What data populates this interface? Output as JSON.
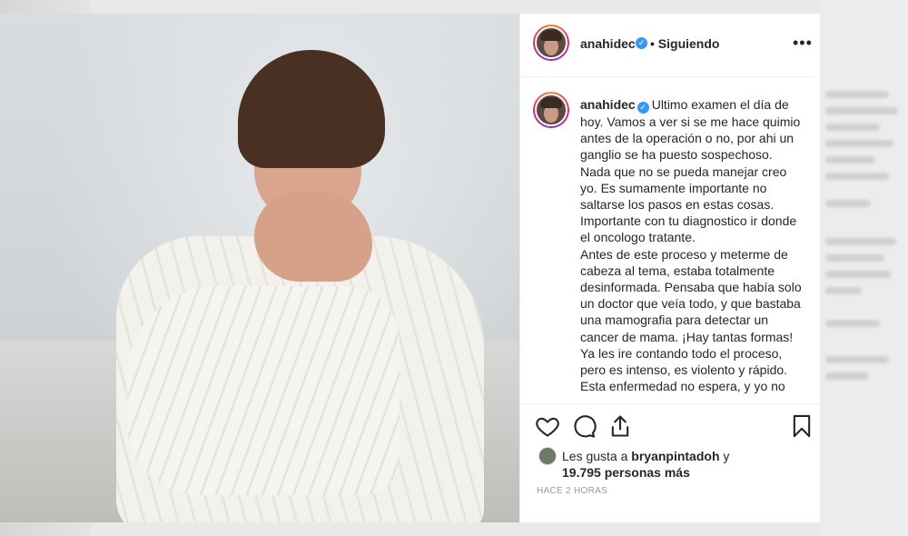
{
  "header": {
    "username": "anahidec",
    "separator": "•",
    "follow_status": "Siguiendo",
    "more_label": "•••"
  },
  "caption": {
    "username": "anahidec",
    "text": "Ultimo examen el día de hoy. Vamos a ver si se me hace quimio antes de la operación o no, por ahi un ganglio se ha puesto sospechoso.\nNada que no se pueda manejar creo yo. Es sumamente importante no saltarse los pasos en estas cosas. Importante con tu diagnostico ir donde el oncologo tratante.\nAntes de este proceso y meterme de cabeza al tema, estaba totalmente desinformada. Pensaba que había solo un doctor que veía todo, y que bastaba una mamografia para detectar un cancer de mama. ¡Hay tantas formas!\nYa les ire contando todo el proceso, pero es intenso, es violento y rápido. Esta enfermedad no espera, y yo no"
  },
  "actions": {
    "like_icon": "heart-icon",
    "comment_icon": "comment-icon",
    "share_icon": "share-icon",
    "save_icon": "bookmark-icon"
  },
  "likes": {
    "prefix": "Les gusta a ",
    "user": "bryanpintadoh",
    "suffix": " y",
    "count_text": "19.795 personas más"
  },
  "timestamp": "HACE 2 HORAS",
  "colors": {
    "verified": "#3897f0",
    "text": "#262626",
    "muted": "#999999",
    "border": "#efefef"
  }
}
